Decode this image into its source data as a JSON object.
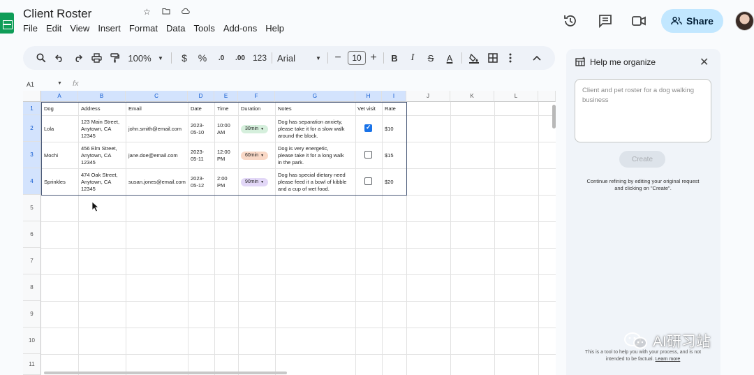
{
  "app": {
    "doc_title": "Client Roster",
    "menu": [
      "File",
      "Edit",
      "View",
      "Insert",
      "Format",
      "Data",
      "Tools",
      "Add-ons",
      "Help"
    ],
    "share_label": "Share"
  },
  "toolbar": {
    "zoom": "100%",
    "currency": "$",
    "percent": "%",
    "dec_decrease": ".0",
    "dec_increase": ".00",
    "number_format": "123",
    "font": "Arial",
    "font_size": "10",
    "minus": "−",
    "plus": "+",
    "bold": "B",
    "italic": "I",
    "strikethrough": "S",
    "text_color": "A"
  },
  "formula_bar": {
    "cell_ref": "A1",
    "fx": "fx"
  },
  "sheet": {
    "columns": [
      "A",
      "B",
      "C",
      "D",
      "E",
      "F",
      "G",
      "H",
      "I",
      "J",
      "K",
      "L"
    ],
    "row_numbers": [
      "1",
      "2",
      "3",
      "4",
      "5",
      "6",
      "7",
      "8",
      "9",
      "10",
      "11"
    ],
    "headers": [
      "Dog",
      "Address",
      "Email",
      "Date",
      "Time",
      "Duration",
      "Notes",
      "Vet visit",
      "Rate"
    ],
    "rows": [
      {
        "dog": "Lola",
        "address": "123 Main Street,\nAnytown, CA\n12345",
        "email": "john.smith@email.com",
        "date": "2023-\n05-10",
        "time": "10:00\nAM",
        "duration": "30min",
        "duration_color": "#d5efdc",
        "notes": "Dog has separation anxiety,\nplease take it for a slow walk\naround the block.",
        "vet_visit": true,
        "rate": "$10"
      },
      {
        "dog": "Mochi",
        "address": "456 Elm Street,\nAnytown, CA\n12345",
        "email": "jane.doe@email.com",
        "date": "2023-\n05-11",
        "time": "12:00\nPM",
        "duration": "60min",
        "duration_color": "#f9d8c6",
        "notes": "Dog is very energetic,\nplease take it for a long walk\nin the park.",
        "vet_visit": false,
        "rate": "$15"
      },
      {
        "dog": "Sprinkles",
        "address": "474 Oak Street,\nAnytown, CA\n12345",
        "email": "susan.jones@email.com",
        "date": "2023-\n05-12",
        "time": "2:00\nPM",
        "duration": "90min",
        "duration_color": "#e2d7f7",
        "notes": "Dog has special dietary need\nplease feed it a bowl of kibble\nand a cup of wet food.",
        "vet_visit": false,
        "rate": "$20"
      }
    ]
  },
  "panel": {
    "title": "Help me organize",
    "prompt": "Client and pet roster for a dog walking business",
    "create_label": "Create",
    "continue_text": "Continue refining by editing your original request and clicking on \"Create\".",
    "disclaimer": "This is a tool to help you with your process, and is not intended to be factual.",
    "learn_more": "Learn more"
  },
  "watermark": "AI研习站",
  "colors": {
    "accent": "#0b57d0",
    "share_bg": "#c2e7ff",
    "sheets_green": "#0f9d58",
    "checkbox_blue": "#1a73e8"
  }
}
